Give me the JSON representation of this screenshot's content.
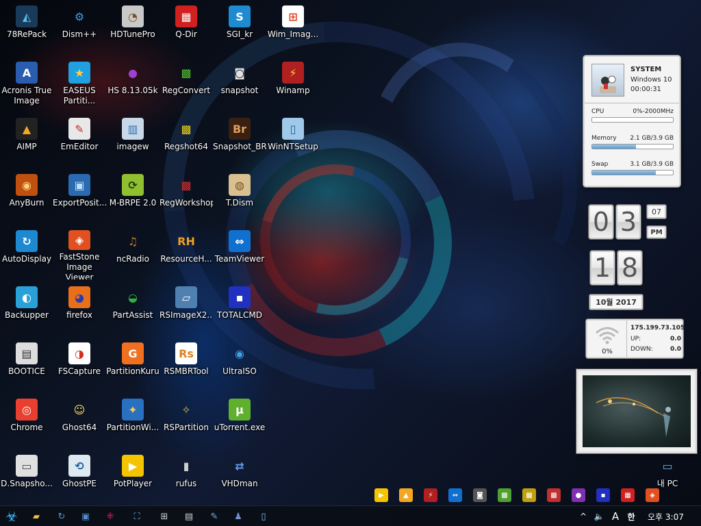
{
  "desktop": {
    "icons": [
      {
        "label": "78RePack",
        "icon": "triangle-logo-icon",
        "glyph": "◭",
        "bg": "#1a3a5a",
        "fg": "#4ec3f0"
      },
      {
        "label": "Acronis True Image",
        "icon": "acronis-icon",
        "glyph": "A",
        "bg": "#2a5db0",
        "fg": "#ffffff"
      },
      {
        "label": "AIMP",
        "icon": "aimp-icon",
        "glyph": "▲",
        "bg": "#222222",
        "fg": "#f5a623"
      },
      {
        "label": "AnyBurn",
        "icon": "disc-icon",
        "glyph": "◉",
        "bg": "#c05010",
        "fg": "#ffd080"
      },
      {
        "label": "AutoDisplay",
        "icon": "autodisplay-icon",
        "glyph": "↻",
        "bg": "#1e88d0",
        "fg": "#ffffff"
      },
      {
        "label": "Backupper",
        "icon": "backupper-icon",
        "glyph": "◐",
        "bg": "#2aa0d8",
        "fg": "#ffffff"
      },
      {
        "label": "BOOTICE",
        "icon": "bootice-icon",
        "glyph": "▤",
        "bg": "#dddddd",
        "fg": "#333333"
      },
      {
        "label": "Chrome",
        "icon": "chrome-icon",
        "glyph": "◎",
        "bg": "#e84030",
        "fg": "#ffffff"
      },
      {
        "label": "D.Snapsho...",
        "icon": "drive-snapshot-icon",
        "glyph": "▭",
        "bg": "#e0e0e0",
        "fg": "#444444"
      },
      {
        "label": "Dism++",
        "icon": "gears-icon",
        "glyph": "⚙",
        "bg": "transparent",
        "fg": "#3aa0f0"
      },
      {
        "label": "EASEUS Partiti...",
        "icon": "easeus-icon",
        "glyph": "★",
        "bg": "#20a0e0",
        "fg": "#ffd040"
      },
      {
        "label": "EmEditor",
        "icon": "emeditor-icon",
        "glyph": "✎",
        "bg": "#e8e8e8",
        "fg": "#c03020"
      },
      {
        "label": "ExportPosit...",
        "icon": "monitor-icon",
        "glyph": "▣",
        "bg": "#2a6ab0",
        "fg": "#bde0ff"
      },
      {
        "label": "FastStone Image Viewer",
        "icon": "faststone-eye-icon",
        "glyph": "◈",
        "bg": "#e05020",
        "fg": "#ffffff"
      },
      {
        "label": "firefox",
        "icon": "firefox-icon",
        "glyph": "◕",
        "bg": "#e8701a",
        "fg": "#2a3ab0"
      },
      {
        "label": "FSCapture",
        "icon": "fscapture-icon",
        "glyph": "◑",
        "bg": "#ffffff",
        "fg": "#d03020"
      },
      {
        "label": "Ghost64",
        "icon": "ghost-icon",
        "glyph": "☺",
        "bg": "transparent",
        "fg": "#ffe060"
      },
      {
        "label": "GhostPE",
        "icon": "ghostpe-icon",
        "glyph": "⟲",
        "bg": "#dde8f0",
        "fg": "#2060a0"
      },
      {
        "label": "HDTunePro",
        "icon": "hdtune-icon",
        "glyph": "◔",
        "bg": "#c8c8c8",
        "fg": "#7a5020"
      },
      {
        "label": "HS 8.13.05k",
        "icon": "purple-monster-icon",
        "glyph": "●",
        "bg": "transparent",
        "fg": "#a040d0"
      },
      {
        "label": "imagew",
        "icon": "imagew-icon",
        "glyph": "▥",
        "bg": "#c8d8e8",
        "fg": "#3070b0"
      },
      {
        "label": "M-BRPE 2.0",
        "icon": "mbrpe-icon",
        "glyph": "⟳",
        "bg": "#90c030",
        "fg": "#204010"
      },
      {
        "label": "ncRadio",
        "icon": "gramophone-icon",
        "glyph": "♫",
        "bg": "transparent",
        "fg": "#c08030"
      },
      {
        "label": "PartAssist",
        "icon": "partassist-icon",
        "glyph": "◒",
        "bg": "transparent",
        "fg": "#30b040"
      },
      {
        "label": "PartitionKuru",
        "icon": "partitionkuru-icon",
        "glyph": "G",
        "bg": "#f07020",
        "fg": "#ffffff"
      },
      {
        "label": "PartitionWi...",
        "icon": "partitionwizard-icon",
        "glyph": "✦",
        "bg": "#2a70c0",
        "fg": "#ffd040"
      },
      {
        "label": "PotPlayer",
        "icon": "potplayer-icon",
        "glyph": "▶",
        "bg": "#f5c400",
        "fg": "#ffffff"
      },
      {
        "label": "Q-Dir",
        "icon": "qdir-icon",
        "glyph": "▦",
        "bg": "#d02020",
        "fg": "#ffffff"
      },
      {
        "label": "RegConvert",
        "icon": "cubes-icon",
        "glyph": "▩",
        "bg": "transparent",
        "fg": "#50c030"
      },
      {
        "label": "Regshot64",
        "icon": "regshot-icon",
        "glyph": "▩",
        "bg": "transparent",
        "fg": "#e8d020"
      },
      {
        "label": "RegWorkshop",
        "icon": "regworkshop-icon",
        "glyph": "▩",
        "bg": "transparent",
        "fg": "#d03030"
      },
      {
        "label": "ResourceH...",
        "icon": "resourcehacker-icon",
        "glyph": "RH",
        "bg": "transparent",
        "fg": "#f0a020"
      },
      {
        "label": "RSImageX2...",
        "icon": "rsimagex-icon",
        "glyph": "▱",
        "bg": "#5080b0",
        "fg": "#ffffff"
      },
      {
        "label": "RSMBRTool",
        "icon": "rsmbrtool-icon",
        "glyph": "Rs",
        "bg": "#ffffff",
        "fg": "#e08020"
      },
      {
        "label": "RSPartition",
        "icon": "rspartition-icon",
        "glyph": "✧",
        "bg": "transparent",
        "fg": "#e0c030"
      },
      {
        "label": "rufus",
        "icon": "usb-icon",
        "glyph": "▮",
        "bg": "transparent",
        "fg": "#cccccc"
      },
      {
        "label": "SGI_kr",
        "icon": "sgi-icon",
        "glyph": "S",
        "bg": "#1e8ad0",
        "fg": "#ffffff"
      },
      {
        "label": "snapshot",
        "icon": "camera-icon",
        "glyph": "◙",
        "bg": "transparent",
        "fg": "#e0e0e0"
      },
      {
        "label": "Snapshot_BR",
        "icon": "bridge-icon",
        "glyph": "Br",
        "bg": "#3a2010",
        "fg": "#e0a060"
      },
      {
        "label": "T.Dism",
        "icon": "tdism-icon",
        "glyph": "◍",
        "bg": "#d8c090",
        "fg": "#7a5020"
      },
      {
        "label": "TeamViewer",
        "icon": "teamviewer-icon",
        "glyph": "⇔",
        "bg": "#1070d0",
        "fg": "#ffffff"
      },
      {
        "label": "TOTALCMD",
        "icon": "floppy-icon",
        "glyph": "▪",
        "bg": "#2030c0",
        "fg": "#ffffff"
      },
      {
        "label": "UltraISO",
        "icon": "ultraiso-icon",
        "glyph": "◉",
        "bg": "transparent",
        "fg": "#40a0e0"
      },
      {
        "label": "uTorrent.exe",
        "icon": "utorrent-icon",
        "glyph": "μ",
        "bg": "#60b030",
        "fg": "#ffffff"
      },
      {
        "label": "VHDman",
        "icon": "vhdman-icon",
        "glyph": "⇄",
        "bg": "transparent",
        "fg": "#60a0f0"
      },
      {
        "label": "Wim_Imag...",
        "icon": "windows-logo-icon",
        "glyph": "⊞",
        "bg": "#ffffff",
        "fg": "#e04020"
      },
      {
        "label": "Winamp",
        "icon": "winamp-icon",
        "glyph": "⚡",
        "bg": "#b02020",
        "fg": "#ffd040"
      },
      {
        "label": "WinNTSetup",
        "icon": "winntsetup-icon",
        "glyph": "▯",
        "bg": "#a0c8e8",
        "fg": "#2060a0"
      },
      {
        "label": "내 PC",
        "icon": "this-pc-icon",
        "glyph": "▭",
        "bg": "transparent",
        "fg": "#60b0f0"
      }
    ]
  },
  "system_gadget": {
    "title": "SYSTEM",
    "os": "Windows 10",
    "uptime": "00:00:31",
    "cpu_label": "CPU",
    "cpu_value": "0%-2000MHz",
    "cpu_fill": 0,
    "mem_label": "Memory",
    "mem_value": "2.1 GB/3.9 GB",
    "mem_fill": 0.54,
    "swap_label": "Swap",
    "swap_value": "3.1 GB/3.9 GB",
    "swap_fill": 0.79
  },
  "clock_gadget": {
    "hour_d1": "0",
    "hour_d2": "3",
    "minute": "07",
    "ampm": "PM",
    "day_d1": "1",
    "day_d2": "8",
    "month_year": "10월 2017"
  },
  "network_gadget": {
    "signal": "0%",
    "ip": "175.199.73.105",
    "up_label": "UP:",
    "up_value": "0.0",
    "down_label": "DOWN:",
    "down_value": "0.0"
  },
  "quick_launch": [
    {
      "icon": "potplayer-icon",
      "glyph": "▶",
      "bg": "#f5c400"
    },
    {
      "icon": "aimp-icon",
      "glyph": "▲",
      "bg": "#f5a623"
    },
    {
      "icon": "winamp-icon",
      "glyph": "⚡",
      "bg": "#b02020"
    },
    {
      "icon": "teamviewer-icon",
      "glyph": "⇔",
      "bg": "#1070d0"
    },
    {
      "icon": "snapshot-icon",
      "glyph": "◙",
      "bg": "#555555"
    },
    {
      "icon": "regconvert-icon",
      "glyph": "▩",
      "bg": "#50a030"
    },
    {
      "icon": "regshot-icon",
      "glyph": "▩",
      "bg": "#c0a010"
    },
    {
      "icon": "regworkshop-icon",
      "glyph": "▩",
      "bg": "#c03030"
    },
    {
      "icon": "hs-icon",
      "glyph": "●",
      "bg": "#8030b0"
    },
    {
      "icon": "totalcmd-icon",
      "glyph": "▪",
      "bg": "#2030c0"
    },
    {
      "icon": "qdir-icon",
      "glyph": "▦",
      "bg": "#d02020"
    },
    {
      "icon": "faststone-icon",
      "glyph": "◈",
      "bg": "#e05020"
    }
  ],
  "taskbar": {
    "pinned": [
      {
        "icon": "biohazard-start-icon",
        "glyph": "☣",
        "color": "#40c0ff"
      },
      {
        "icon": "file-explorer-icon",
        "glyph": "▰",
        "color": "#f0c040"
      },
      {
        "icon": "autodisplay-icon",
        "glyph": "↻",
        "color": "#40a0e0"
      },
      {
        "icon": "monitor-icon",
        "glyph": "▣",
        "color": "#5090d0"
      },
      {
        "icon": "grid-pink-icon",
        "glyph": "⁜",
        "color": "#e0207a"
      },
      {
        "icon": "expand-icon",
        "glyph": "⛶",
        "color": "#60b0f0"
      },
      {
        "icon": "network-icon",
        "glyph": "⊞",
        "color": "#d0d0d0"
      },
      {
        "icon": "printer-icon",
        "glyph": "▤",
        "color": "#d0d0d0"
      },
      {
        "icon": "pen-icon",
        "glyph": "✎",
        "color": "#70b0e0"
      },
      {
        "icon": "people-icon",
        "glyph": "♟",
        "color": "#7090d0"
      },
      {
        "icon": "document-icon",
        "glyph": "▯",
        "color": "#80c0f0"
      }
    ],
    "tray_chevron": "^",
    "volume": "🔈",
    "ime_mode": "A",
    "ime_lang": "한",
    "time": "오후 3:07"
  }
}
